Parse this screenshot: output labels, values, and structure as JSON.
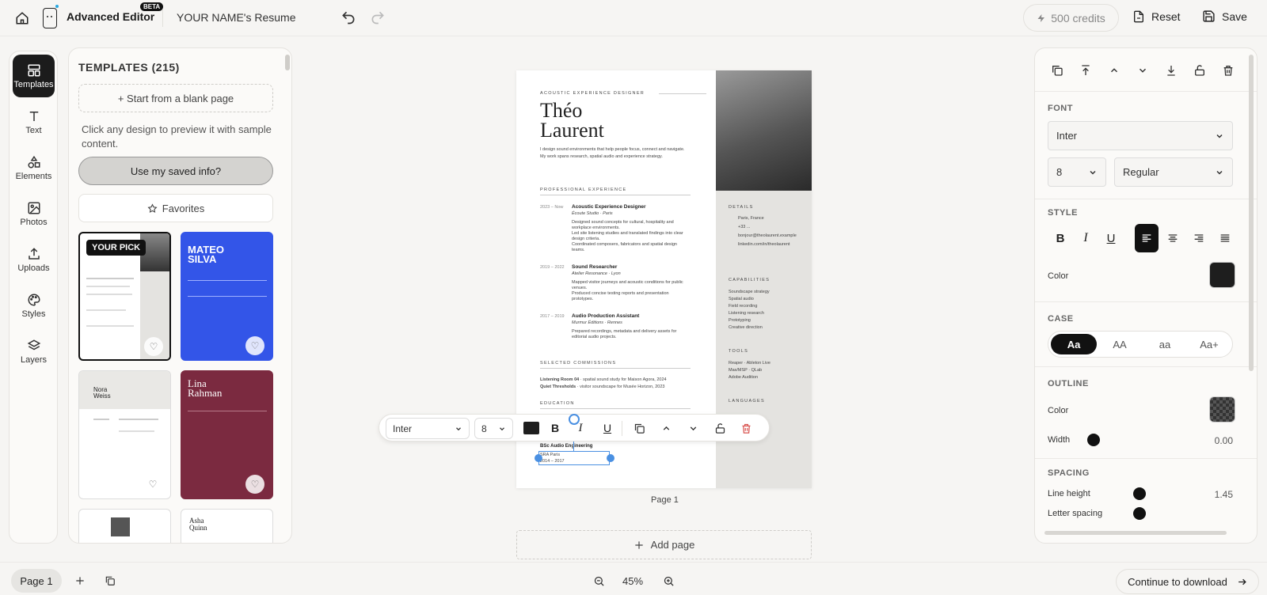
{
  "header": {
    "app_name": "Advanced Editor",
    "beta_badge": "BETA",
    "document_title": "YOUR NAME's Resume",
    "credits": "500 credits",
    "reset_label": "Reset",
    "save_label": "Save"
  },
  "rail": {
    "items": [
      {
        "label": "Templates",
        "icon": "templates-icon",
        "active": true
      },
      {
        "label": "Text",
        "icon": "text-icon"
      },
      {
        "label": "Elements",
        "icon": "shapes-icon"
      },
      {
        "label": "Photos",
        "icon": "image-icon"
      },
      {
        "label": "Uploads",
        "icon": "upload-icon"
      },
      {
        "label": "Styles",
        "icon": "palette-icon"
      },
      {
        "label": "Layers",
        "icon": "layers-icon"
      }
    ]
  },
  "templates_panel": {
    "title": "TEMPLATES (215)",
    "blank_button": "+ Start from a blank page",
    "hint": "Click any design to preview it with sample content.",
    "saved_info_button": "Use my saved info?",
    "favorites_button": "Favorites",
    "your_pick_badge": "YOUR PICK",
    "thumbs": [
      {
        "name": ""
      },
      {
        "name": "MATEO SILVA"
      },
      {
        "name": "Nora Weiss"
      },
      {
        "name": "Lina Rahman"
      },
      {
        "name": ""
      },
      {
        "name": "Asha Quinn"
      }
    ]
  },
  "resume": {
    "role": "ACOUSTIC EXPERIENCE DESIGNER",
    "first_name": "Théo",
    "last_name": "Laurent",
    "summary": "I design sound environments that help people focus, connect and navigate. My work spans research, spatial audio and experience strategy.",
    "experience_heading": "PROFESSIONAL EXPERIENCE",
    "jobs": [
      {
        "dates": "2023 – Now",
        "title": "Acoustic Experience Designer",
        "company": "Écoute Studio · Paris",
        "bullets": "Designed sound concepts for cultural, hospitality and workplace environments.\nLed site listening studies and translated findings into clear design criteria.\nCoordinated composers, fabricators and spatial design teams."
      },
      {
        "dates": "2019 – 2022",
        "title": "Sound Researcher",
        "company": "Atelier Resonance · Lyon",
        "bullets": "Mapped visitor journeys and acoustic conditions for public venues.\nProduced concise testing reports and presentation prototypes."
      },
      {
        "dates": "2017 – 2019",
        "title": "Audio Production Assistant",
        "company": "Murmur Éditions · Rennes",
        "bullets": "Prepared recordings, metadata and delivery assets for editorial audio projects."
      }
    ],
    "commissions_heading": "SELECTED COMMISSIONS",
    "commission_1_title": "Listening Room 04",
    "commission_1_text": "· spatial sound study for Maison Agora, 2024",
    "commission_2_title": "Quiet Thresholds",
    "commission_2_text": "· visitor soundscape for Musée Horizon, 2023",
    "education_heading": "EDUCATION",
    "degree": "BSc Audio Engineering",
    "school": "SRA Paris",
    "edu_dates": "2014 – 2017",
    "details_heading": "DETAILS",
    "details": [
      "Paris, France",
      "+33 ...",
      "bonjour@theolaurent.example",
      "linkedin.com/in/theolaurent"
    ],
    "capabilities_heading": "CAPABILITIES",
    "capabilities": [
      "Soundscape strategy",
      "Spatial audio",
      "Field recording",
      "Listening research",
      "Prototyping",
      "Creative direction"
    ],
    "tools_heading": "TOOLS",
    "tools": [
      "Reaper · Ableton Live",
      "Max/MSP · QLab",
      "Adobe Audition"
    ],
    "languages_heading": "LANGUAGES"
  },
  "canvas": {
    "page_label": "Page 1",
    "add_page": "Add page"
  },
  "floating_toolbar": {
    "font": "Inter",
    "size": "8",
    "color": "#1e1e1e"
  },
  "props_panel": {
    "font_heading": "FONT",
    "font_family": "Inter",
    "font_size": "8",
    "font_weight": "Regular",
    "style_heading": "STYLE",
    "color_label": "Color",
    "text_color": "#1e1e1e",
    "case_heading": "CASE",
    "case_options": [
      "Aa",
      "AA",
      "aa",
      "Aa+"
    ],
    "outline_heading": "OUTLINE",
    "outline_color_label": "Color",
    "width_label": "Width",
    "width_value": "0.00",
    "spacing_heading": "SPACING",
    "line_height_label": "Line height",
    "line_height_value": "1.45",
    "letter_spacing_label": "Letter spacing"
  },
  "footer": {
    "page_pill": "Page 1",
    "zoom": "45%",
    "continue_label": "Continue to download"
  },
  "colors": {
    "accent_blue": "#4a90e2",
    "dark": "#1c1c1c",
    "delete_red": "#d9534f"
  }
}
